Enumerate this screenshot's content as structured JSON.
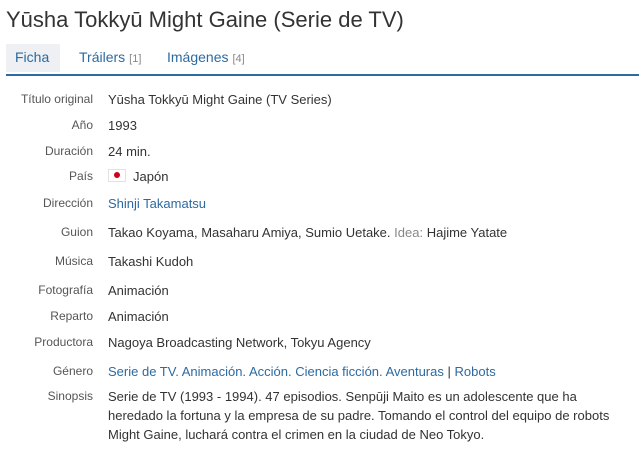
{
  "title": "Yūsha Tokkyū Might Gaine (Serie de TV)",
  "tabs": [
    {
      "label": "Ficha",
      "count": ""
    },
    {
      "label": "Tráilers",
      "count": "[1]"
    },
    {
      "label": "Imágenes",
      "count": "[4]"
    }
  ],
  "details": {
    "original_title": {
      "label": "Título original",
      "value": "Yūsha Tokkyū Might Gaine (TV Series)"
    },
    "year": {
      "label": "Año",
      "value": "1993"
    },
    "duration": {
      "label": "Duración",
      "value": "24 min."
    },
    "country": {
      "label": "País",
      "value": "Japón",
      "flag_icon": "japan-flag-icon"
    },
    "director": {
      "label": "Dirección",
      "value": "Shinji Takamatsu"
    },
    "screenplay": {
      "label": "Guion",
      "value": "Takao Koyama, Masaharu Amiya, Sumio Uetake.",
      "idea_label": "Idea:",
      "idea_value": "Hajime Yatate"
    },
    "music": {
      "label": "Música",
      "value": "Takashi Kudoh"
    },
    "photography": {
      "label": "Fotografía",
      "value": "Animación"
    },
    "cast": {
      "label": "Reparto",
      "value": "Animación"
    },
    "production": {
      "label": "Productora",
      "value": "Nagoya Broadcasting Network, Tokyu Agency"
    },
    "genre": {
      "label": "Género",
      "items": [
        "Serie de TV.",
        "Animación.",
        "Acción.",
        "Ciencia ficción.",
        "Aventuras"
      ],
      "separator": "|",
      "extra": "Robots"
    },
    "synopsis": {
      "label": "Sinopsis",
      "value": "Serie de TV (1993 - 1994). 47 episodios. Senpūji Maito es un adolescente que ha heredado la fortuna y la empresa de su padre. Tomando el control del equipo de robots Might Gaine, luchará contra el crimen en la ciudad de Neo Tokyo."
    }
  },
  "colors": {
    "link": "#2c6aa0",
    "tab_underline": "#2c6aa0",
    "active_tab_bg": "#eef0f3"
  }
}
